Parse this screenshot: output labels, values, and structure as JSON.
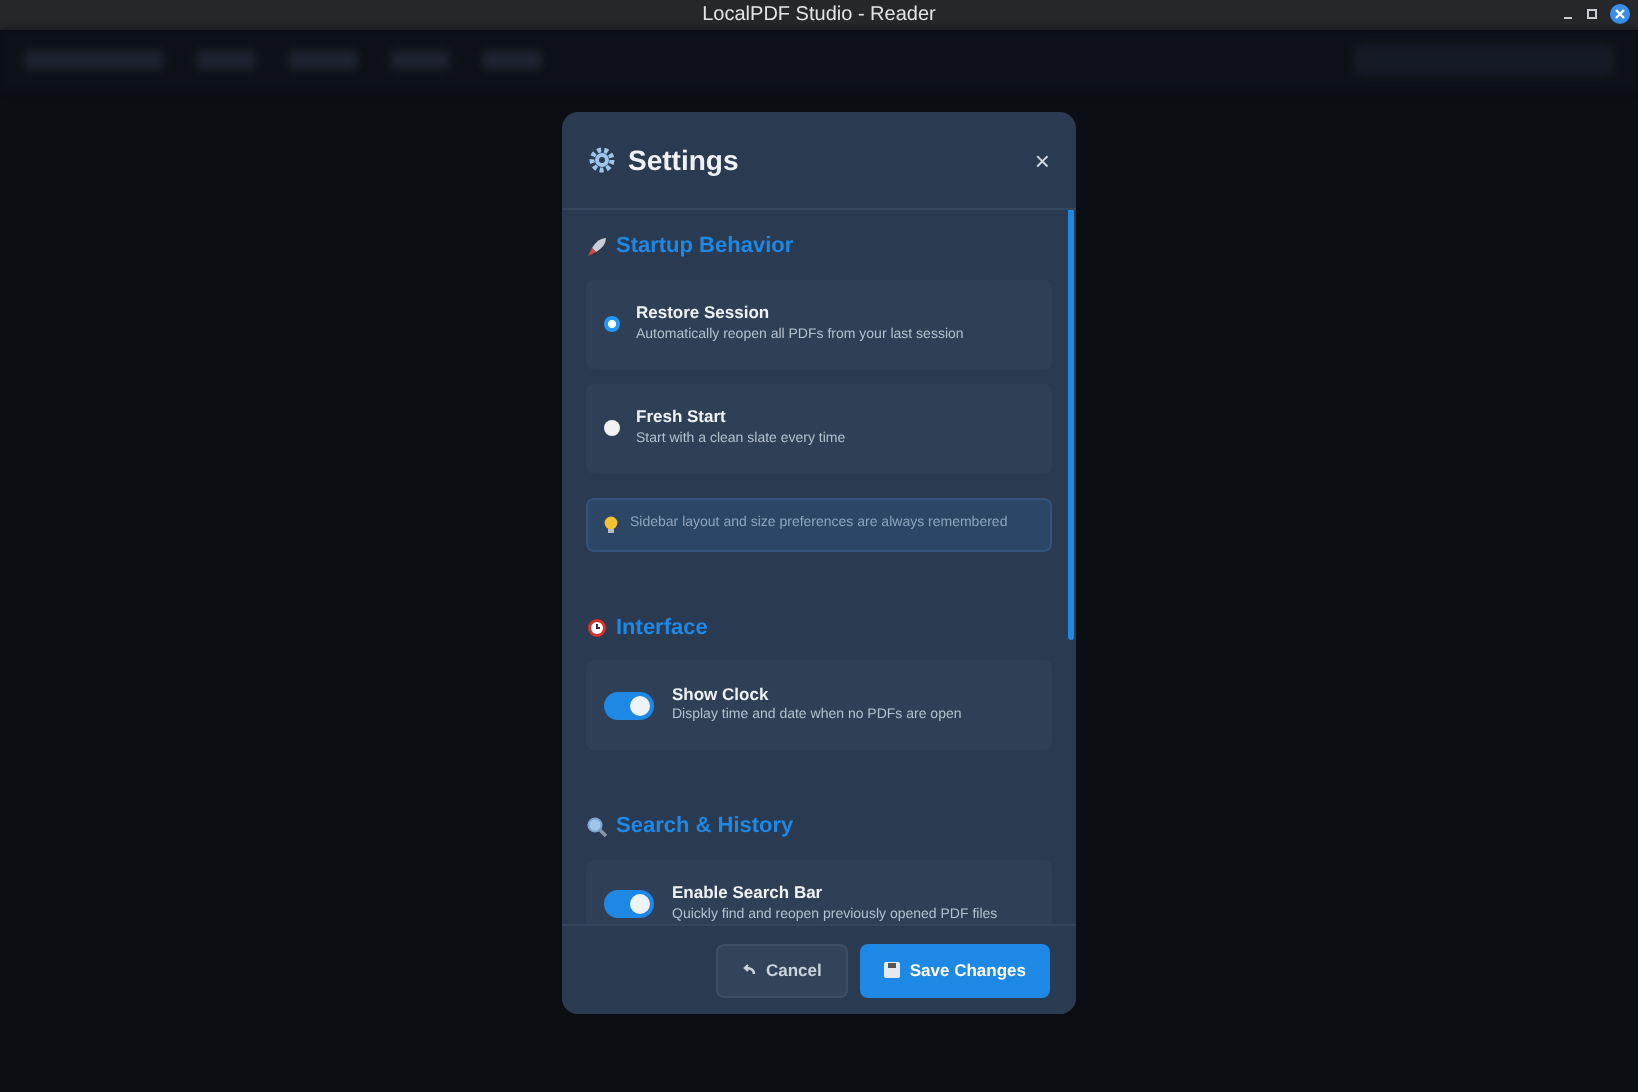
{
  "window": {
    "title": "LocalPDF Studio - Reader"
  },
  "dialog": {
    "title": "Settings",
    "close": "×",
    "sections": [
      {
        "title": "Startup Behavior",
        "items": [
          {
            "kind": "radio",
            "label": "Restore Session",
            "description": "Automatically reopen all PDFs from your last session",
            "selected": true
          },
          {
            "kind": "radio",
            "label": "Fresh Start",
            "description": "Start with a clean slate every time",
            "selected": false
          },
          {
            "kind": "note",
            "text": "Sidebar layout and size preferences are always remembered"
          }
        ]
      },
      {
        "title": "Interface",
        "items": [
          {
            "kind": "toggle",
            "label": "Show Clock",
            "description": "Display time and date when no PDFs are open",
            "on": true
          }
        ]
      },
      {
        "title": "Search & History",
        "items": [
          {
            "kind": "toggle",
            "label": "Enable Search Bar",
            "description": "Quickly find and reopen previously opened PDF files",
            "on": true
          }
        ]
      }
    ],
    "buttons": [
      {
        "kind": "secondary",
        "label": "Cancel"
      },
      {
        "kind": "primary",
        "label": "Save Changes"
      }
    ]
  }
}
